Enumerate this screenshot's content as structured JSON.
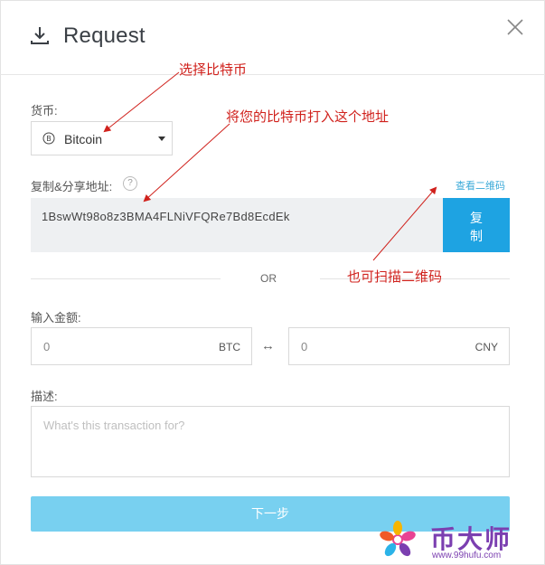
{
  "dialog": {
    "title": "Request"
  },
  "currency": {
    "label": "货币:",
    "selected": "Bitcoin"
  },
  "address": {
    "label": "复制&分享地址:",
    "help": "?",
    "qr_link": "查看二维码",
    "value": "1BswWt98o8z3BMA4FLNiVFQRe7Bd8EcdEk",
    "copy_l1": "复",
    "copy_l2": "制"
  },
  "or_text": "OR",
  "amount": {
    "label": "输入金额:",
    "btc_value": "0",
    "btc_unit": "BTC",
    "swap": "↔",
    "cny_value": "0",
    "cny_unit": "CNY"
  },
  "description": {
    "label": "描述:",
    "placeholder": "What's this transaction for?"
  },
  "next_label": "下一步",
  "annotations": {
    "select_btc": "选择比特币",
    "send_to_address": "将您的比特币打入这个地址",
    "scan_qr": "也可扫描二维码"
  },
  "watermark": {
    "brand": "币大师",
    "url": "www.99hufu.com"
  },
  "colors": {
    "accent": "#1ea3e2",
    "next_button": "#78d0f0",
    "annotation": "#d0211c",
    "watermark": "#7b3fb0"
  }
}
